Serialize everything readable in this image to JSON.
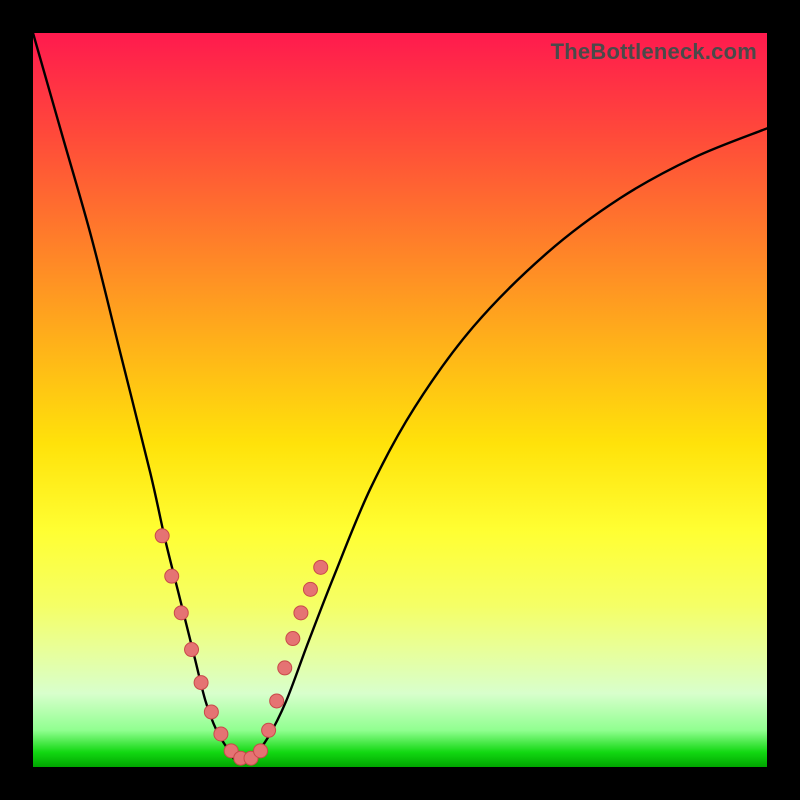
{
  "watermark": "TheBottleneck.com",
  "colors": {
    "marker_fill": "#E57373",
    "marker_stroke": "#C94A4A",
    "curve": "#000000",
    "frame": "#000000"
  },
  "chart_data": {
    "type": "line",
    "title": "",
    "xlabel": "",
    "ylabel": "",
    "xlim": [
      0,
      1
    ],
    "ylim": [
      0,
      1
    ],
    "grid": false,
    "legend": false,
    "series": [
      {
        "name": "bottleneck-curve",
        "x_norm": [
          0.0,
          0.04,
          0.08,
          0.12,
          0.16,
          0.18,
          0.2,
          0.22,
          0.235,
          0.25,
          0.265,
          0.275,
          0.285,
          0.3,
          0.32,
          0.345,
          0.375,
          0.41,
          0.46,
          0.52,
          0.6,
          0.7,
          0.8,
          0.9,
          1.0
        ],
        "y_norm": [
          1.0,
          0.86,
          0.72,
          0.56,
          0.4,
          0.31,
          0.23,
          0.15,
          0.09,
          0.05,
          0.025,
          0.01,
          0.01,
          0.015,
          0.04,
          0.09,
          0.17,
          0.26,
          0.38,
          0.49,
          0.6,
          0.7,
          0.775,
          0.83,
          0.87
        ]
      }
    ],
    "markers": {
      "name": "highlighted-points",
      "x_norm": [
        0.176,
        0.189,
        0.202,
        0.216,
        0.229,
        0.243,
        0.256,
        0.27,
        0.283,
        0.297,
        0.31,
        0.321,
        0.332,
        0.343,
        0.354,
        0.365,
        0.378,
        0.392
      ],
      "y_norm": [
        0.315,
        0.26,
        0.21,
        0.16,
        0.115,
        0.075,
        0.045,
        0.022,
        0.012,
        0.012,
        0.022,
        0.05,
        0.09,
        0.135,
        0.175,
        0.21,
        0.242,
        0.272
      ],
      "radius_px": 7
    }
  }
}
